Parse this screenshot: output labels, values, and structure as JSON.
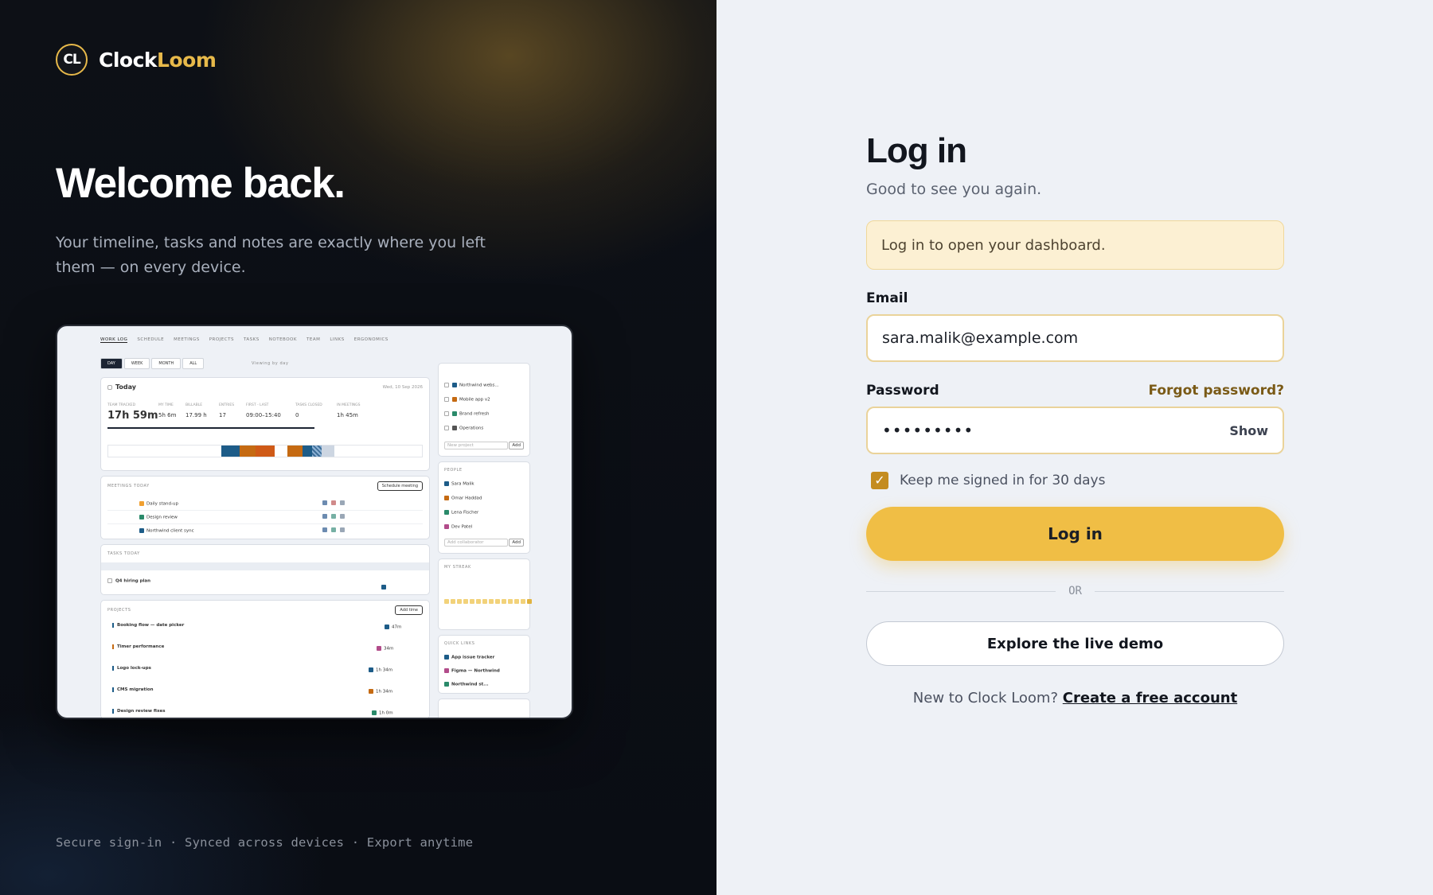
{
  "brand": {
    "name_a": "Clock",
    "name_b": "Loom",
    "logo_text": "CL"
  },
  "hero": {
    "title": "Welcome back.",
    "lead": "Your timeline, tasks and notes are exactly where you left them — on every device.",
    "footnote": "Secure sign-in · Synced across devices · Export anytime"
  },
  "preview": {
    "tabs": [
      "WORK LOG",
      "SCHEDULE",
      "MEETINGS",
      "PROJECTS",
      "TASKS",
      "NOTEBOOK",
      "TEAM",
      "LINKS",
      "ERGONOMICS"
    ],
    "segments": [
      "DAY",
      "WEEK",
      "MONTH",
      "ALL"
    ],
    "viewing": "Viewing by day",
    "today": "Today",
    "date": "Wed, 10 Sep 2026",
    "stats": [
      {
        "label": "TEAM TRACKED",
        "value": "17h 59m"
      },
      {
        "label": "MY TIME",
        "value": "5h 6m"
      },
      {
        "label": "BILLABLE",
        "value": "17.99 h"
      },
      {
        "label": "ENTRIES",
        "value": "17"
      },
      {
        "label": "FIRST - LAST",
        "value": "09:00–15:40"
      },
      {
        "label": "TASKS CLOSED",
        "value": "0"
      },
      {
        "label": "IN MEETINGS",
        "value": "1h 45m"
      }
    ],
    "meetings_title": "MEETINGS TODAY",
    "schedule_btn": "Schedule meeting",
    "meetings": [
      "Daily stand-up",
      "Design review",
      "Northwind client sync"
    ],
    "tasks_title": "TASKS TODAY",
    "task": "Q4 hiring plan",
    "projects_title": "PROJECTS",
    "add_time": "Add time",
    "entries": [
      {
        "name": "Booking flow — date picker",
        "dur": "47m"
      },
      {
        "name": "Timer performance",
        "dur": "34m"
      },
      {
        "name": "Logo lock-ups",
        "dur": "1h 34m"
      },
      {
        "name": "CMS migration",
        "dur": "1h 34m"
      },
      {
        "name": "Design review fixes",
        "dur": "1h 0m"
      }
    ],
    "side_projects": [
      "Northwind webs...",
      "Mobile app v2",
      "Brand refresh",
      "Operations"
    ],
    "new_project": "New project",
    "add": "Add",
    "people_title": "PEOPLE",
    "people": [
      "Sara Malik",
      "Omar Haddad",
      "Lena Fischer",
      "Dev Patel"
    ],
    "add_collab": "Add collaborator",
    "streak_title": "MY STREAK",
    "links_title": "QUICK LINKS",
    "links": [
      "App issue tracker",
      "Figma — Northwind",
      "Northwind st..."
    ]
  },
  "login": {
    "title": "Log in",
    "subtitle": "Good to see you again.",
    "notice": "Log in to open your dashboard.",
    "email_label": "Email",
    "email_value": "sara.malik@example.com",
    "password_label": "Password",
    "forgot": "Forgot password?",
    "password_mask": "•••••••••",
    "show": "Show",
    "keep_signed": "Keep me signed in for 30 days",
    "submit": "Log in",
    "or": "OR",
    "demo": "Explore the live demo",
    "new_prefix": "New to Clock Loom?",
    "create": "Create a free account"
  },
  "colors": {
    "accent": "#f0be45",
    "accent_dark": "#c48c20",
    "brand_gold": "#e7b94a",
    "hero_bg": "#0b0e14"
  }
}
